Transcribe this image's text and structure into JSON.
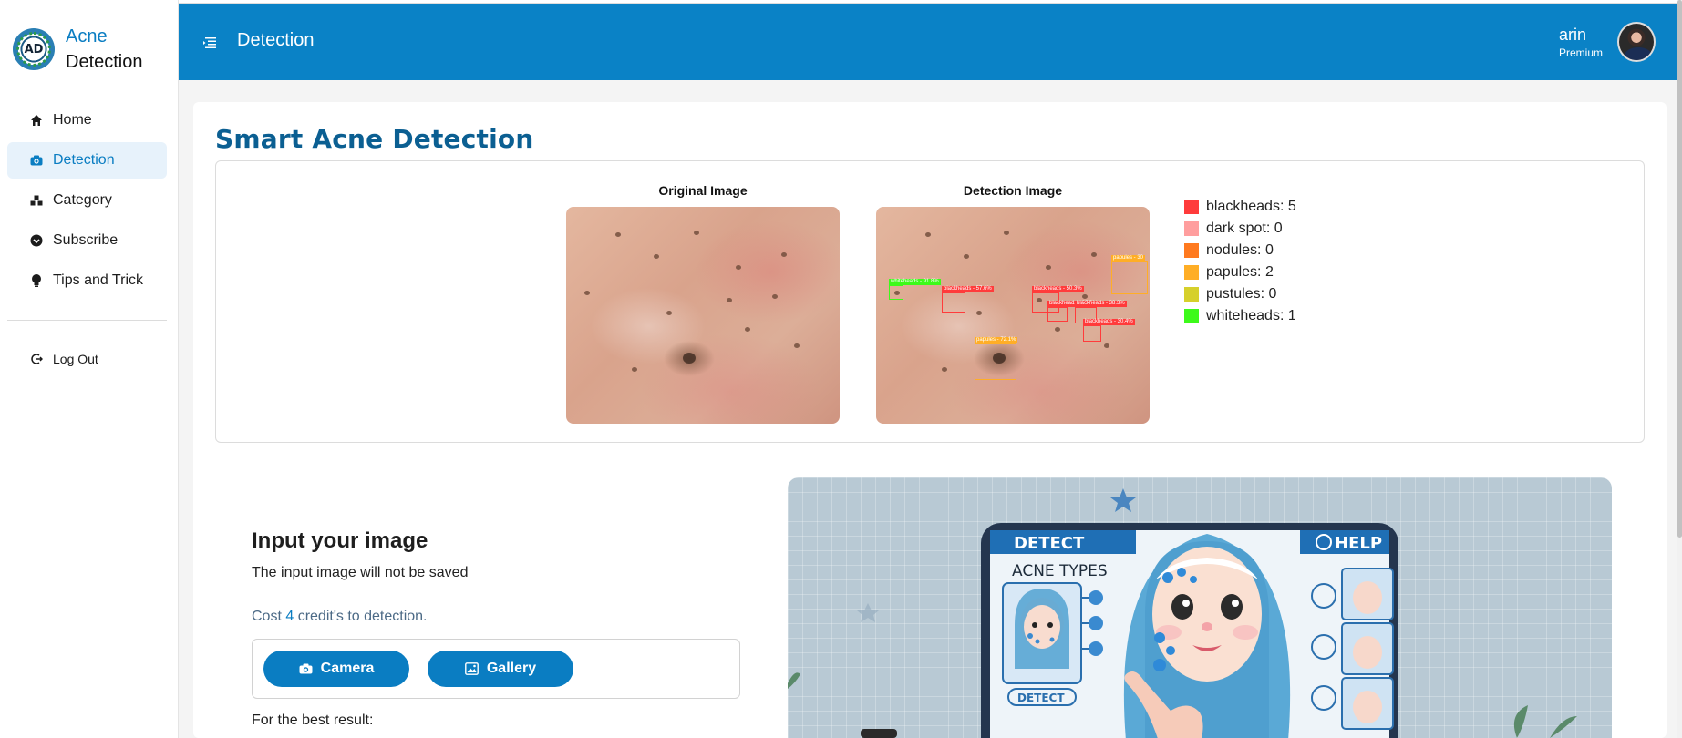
{
  "brand": {
    "line1": "Acne",
    "line2": "Detection",
    "logo_text": "AD"
  },
  "sidebar": {
    "items": [
      {
        "label": "Home",
        "icon": "home-icon",
        "active": false
      },
      {
        "label": "Detection",
        "icon": "camera-icon",
        "active": true
      },
      {
        "label": "Category",
        "icon": "category-icon",
        "active": false
      },
      {
        "label": "Subscribe",
        "icon": "subscribe-icon",
        "active": false
      },
      {
        "label": "Tips and Trick",
        "icon": "bulb-icon",
        "active": false
      }
    ],
    "logout": "Log Out"
  },
  "header": {
    "title": "Detection",
    "user_name": "arin",
    "user_plan": "Premium"
  },
  "main": {
    "title": "Smart Acne Detection",
    "original_caption": "Original Image",
    "detection_caption": "Detection Image",
    "legend": [
      {
        "label": "blackheads: 5",
        "color": "#ff3b3b"
      },
      {
        "label": "dark spot: 0",
        "color": "#ff9e9e"
      },
      {
        "label": "nodules: 0",
        "color": "#ff7a1f"
      },
      {
        "label": "papules: 2",
        "color": "#ffae26"
      },
      {
        "label": "pustules: 0",
        "color": "#d6d02b"
      },
      {
        "label": "whiteheads: 1",
        "color": "#3dfa1a"
      }
    ],
    "detections": [
      {
        "label": "whiteheads - 91.8%",
        "color": "#3dfa1a"
      },
      {
        "label": "blackheads - 57.6%",
        "color": "#ff3b3b"
      },
      {
        "label": "blackheads - 50.3%",
        "color": "#ff3b3b"
      },
      {
        "label": "blackheads - 20.6%",
        "color": "#ff3b3b"
      },
      {
        "label": "blackheads - 38.3%",
        "color": "#ff3b3b"
      },
      {
        "label": "blackheads - 30.4%",
        "color": "#ff3b3b"
      },
      {
        "label": "papules - 30",
        "color": "#ffae26"
      },
      {
        "label": "papules - 72.1%",
        "color": "#ffae26"
      }
    ]
  },
  "input": {
    "title": "Input your image",
    "note": "The input image will not be saved",
    "cost_prefix": "Cost ",
    "cost_value": "4",
    "cost_suffix": " credit's to detection.",
    "camera_label": "Camera",
    "gallery_label": "Gallery",
    "best_result": "For the best result:"
  },
  "illustration": {
    "detect_label": "DETECT",
    "help_label": "HELP",
    "acne_types_label": "ACNE TYPES",
    "detect_button_label": "DETECT"
  }
}
